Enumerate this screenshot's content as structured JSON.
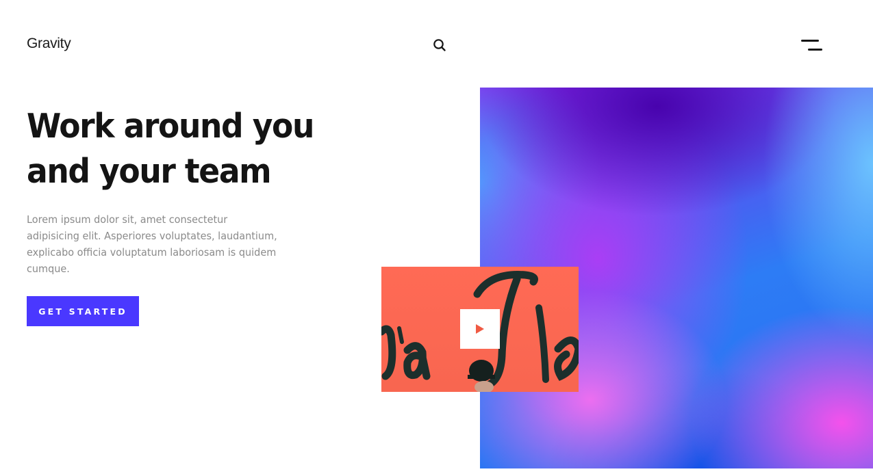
{
  "header": {
    "logo_text": "Gravity",
    "search_icon": "search-icon",
    "menu_icon": "hamburger-menu-icon"
  },
  "hero": {
    "title": "Work around you and your team",
    "description": "Lorem ipsum dolor sit, amet consectetur adipisicing elit. Asperiores voluptates, laudantium, explicabo officia voluptatum laboriosam is quidem cumque.",
    "cta_label": "GET STARTED"
  },
  "media": {
    "play_icon": "play-icon"
  },
  "colors": {
    "accent": "#4a38ff",
    "text_dark": "#141414",
    "text_muted": "#8a8a8a",
    "video_bg": "#ff6a55"
  }
}
